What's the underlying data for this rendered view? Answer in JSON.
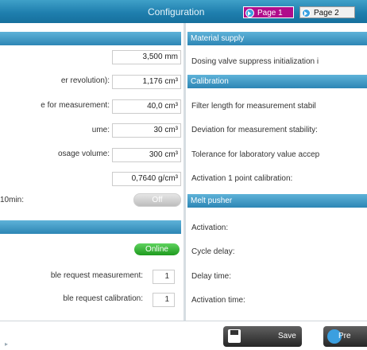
{
  "header": {
    "title": "Configuration",
    "tabs": [
      {
        "label": "Page 1",
        "active": true
      },
      {
        "label": "Page 2",
        "active": false
      }
    ]
  },
  "left": {
    "fields": [
      {
        "label": "",
        "value": "3,500 mm"
      },
      {
        "label": "er revolution):",
        "value": "1,176 cm³"
      },
      {
        "label": "e for measurement:",
        "value": "40,0 cm³"
      },
      {
        "label": "ume:",
        "value": "30 cm³"
      },
      {
        "label": "osage volume:",
        "value": "300 cm³"
      },
      {
        "label": "",
        "value": "0,7640 g/cm³"
      }
    ],
    "toggle_row": {
      "label": "10min:",
      "state": "Off"
    },
    "online_row": {
      "state": "Online"
    },
    "requests": [
      {
        "label": "ble request measurement:",
        "value": "1"
      },
      {
        "label": "ble request calibration:",
        "value": "1"
      }
    ]
  },
  "right": {
    "material_supply": {
      "title": "Material supply",
      "items": [
        "Dosing valve suppress initialization i"
      ]
    },
    "calibration": {
      "title": "Calibration",
      "items": [
        "Filter length for measurement stabil",
        "Deviation for measurement stability:",
        "Tolerance for laboratory value accep",
        "Activation 1 point calibration:"
      ]
    },
    "melt_pusher": {
      "title": "Melt pusher",
      "items": [
        "Activation:",
        "Cycle delay:",
        "Delay time:",
        "Activation time:"
      ]
    }
  },
  "footer": {
    "save_label": "Save",
    "pre_label": "Pre"
  },
  "colors": {
    "header": "#1f7fae",
    "section": "#3a92c0",
    "active_tab": "#b00c8b",
    "online": "#2aa82a"
  }
}
